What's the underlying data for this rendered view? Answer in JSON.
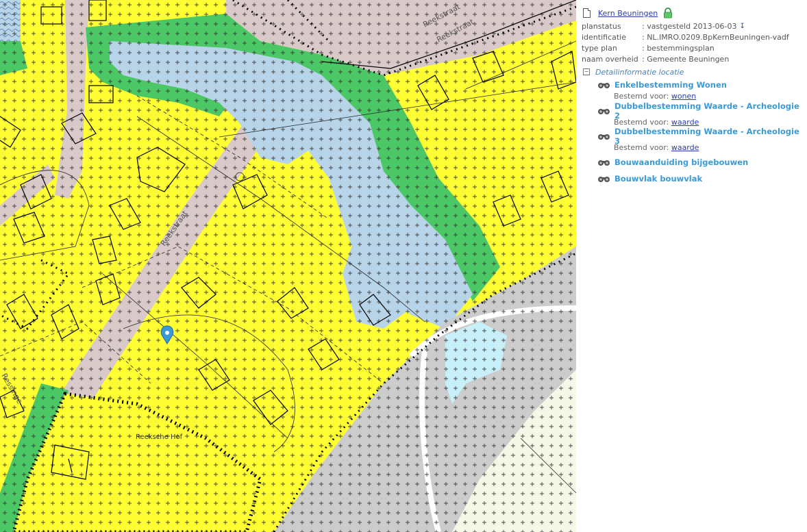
{
  "map": {
    "street_labels": [
      "Reekstraat",
      "Reekstraat",
      "Reekstraat",
      "Reeksche Hof",
      "Ressinge"
    ],
    "colors": {
      "residential": "#ffff33",
      "water": "#b7d4e8",
      "green": "#4cc765",
      "road": "#d9c9c9",
      "railway": "#cccccc",
      "light_water": "#c8f0fa",
      "marker": "#3a9ad6"
    },
    "marker_icon": "map-pin-icon"
  },
  "panel": {
    "plan_name": "Kern Beuningen",
    "plan_icon": "document-icon",
    "lock_icon": "lock-icon",
    "metadata": [
      {
        "key": "planstatus",
        "value": ": vastgesteld 2013-06-03"
      },
      {
        "key": "identificatie",
        "value": ": NL.IMRO.0209.BpKernBeuningen-vadf"
      },
      {
        "key": "type plan",
        "value": ": bestemmingsplan"
      },
      {
        "key": "naam overheid",
        "value": ": Gemeente Beuningen"
      }
    ],
    "detail_title": "Detailinformatie locatie",
    "entries": [
      {
        "name": "Enkelbestemming Wonen",
        "sub_prefix": "Bestemd voor:",
        "sub_link": "wonen"
      },
      {
        "name": "Dubbelbestemming Waarde - Archeologie 2",
        "sub_prefix": "Bestemd voor:",
        "sub_link": "waarde"
      },
      {
        "name": "Dubbelbestemming Waarde - Archeologie 3",
        "sub_prefix": "Bestemd voor:",
        "sub_link": "waarde"
      },
      {
        "name": "Bouwaanduiding bijgebouwen"
      },
      {
        "name": "Bouwvlak bouwvlak"
      }
    ]
  }
}
